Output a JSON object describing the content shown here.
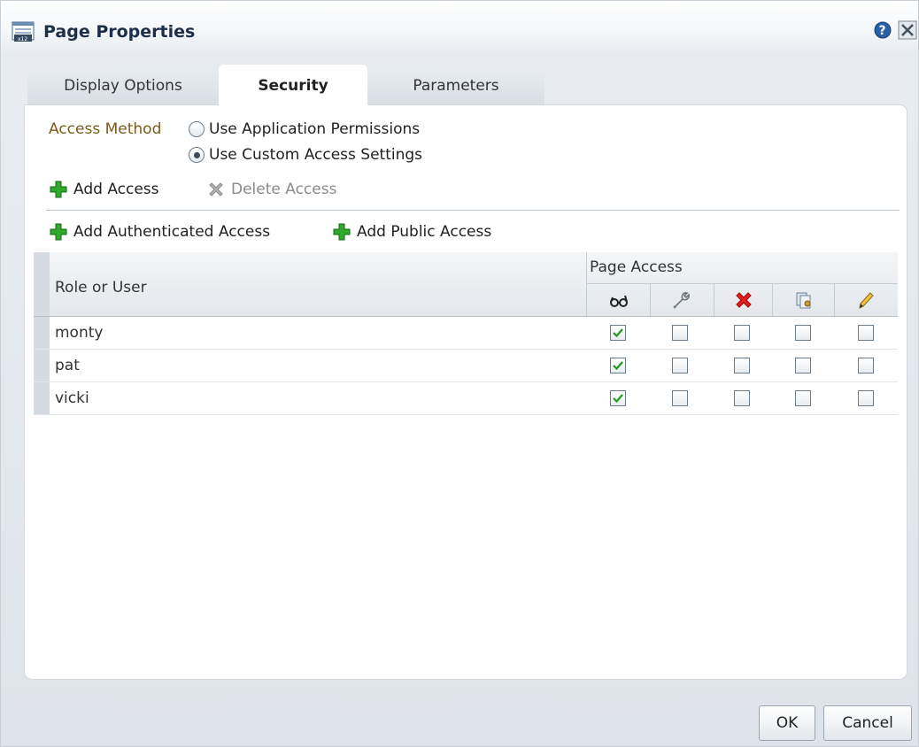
{
  "title": "Page Properties",
  "tabs": [
    {
      "label": "Display Options",
      "active": false
    },
    {
      "label": "Security",
      "active": true
    },
    {
      "label": "Parameters",
      "active": false
    }
  ],
  "access_method": {
    "label": "Access Method",
    "options": [
      {
        "label": "Use Application Permissions",
        "selected": false
      },
      {
        "label": "Use Custom Access Settings",
        "selected": true
      }
    ]
  },
  "actions": {
    "add_access": "Add Access",
    "delete_access": "Delete Access",
    "add_authenticated": "Add Authenticated Access",
    "add_public": "Add Public Access"
  },
  "table": {
    "col_role": "Role or User",
    "col_group": "Page Access",
    "permission_icons": [
      "view-icon",
      "customize-icon",
      "delete-icon",
      "grant-icon",
      "edit-icon"
    ],
    "rows": [
      {
        "name": "monty",
        "perms": [
          true,
          false,
          false,
          false,
          false
        ]
      },
      {
        "name": "pat",
        "perms": [
          true,
          false,
          false,
          false,
          false
        ]
      },
      {
        "name": "vicki",
        "perms": [
          true,
          false,
          false,
          false,
          false
        ]
      }
    ]
  },
  "buttons": {
    "ok": "OK",
    "cancel": "Cancel"
  },
  "colors": {
    "accent_green": "#1f9a1f",
    "title_text": "#1c2f48",
    "label_gold": "#7a5a18"
  }
}
